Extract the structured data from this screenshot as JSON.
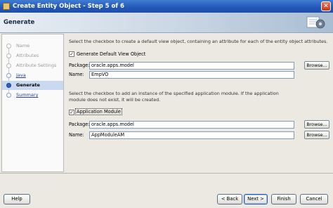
{
  "window": {
    "title": "Create Entity Object - Step 5 of 6"
  },
  "header": {
    "title": "Generate"
  },
  "nav": {
    "items": [
      {
        "label": "Name",
        "state": "done"
      },
      {
        "label": "Attributes",
        "state": "done"
      },
      {
        "label": "Attribute Settings",
        "state": "done"
      },
      {
        "label": "Java",
        "state": "link"
      },
      {
        "label": "Generate",
        "state": "current"
      },
      {
        "label": "Summary",
        "state": "link"
      }
    ]
  },
  "section1": {
    "description": "Select the checkbox to create a default view object, containing an attribute for each of the entity object attributes.",
    "checkbox_label": "Generate Default View Object",
    "checked": true,
    "package_label": "Package:",
    "package_value": "oracle.apps.model",
    "name_label": "Name:",
    "name_value": "EmpVO",
    "browse_label": "Browse..."
  },
  "section2": {
    "description_line1": "Select the checkbox to add an instance of the specified application module.  If the application",
    "description_line2": "module does not exist, it will be created.",
    "checkbox_label": "Application Module",
    "checked": true,
    "package_label": "Package:",
    "package_value": "oracle.apps.model",
    "name_label": "Name:",
    "name_value": "AppModuleAM",
    "browse_label": "Browse...",
    "browse2_label": "Browse..."
  },
  "buttons": {
    "help": "Help",
    "back": "< Back",
    "next": "Next >",
    "finish": "Finish",
    "cancel": "Cancel"
  },
  "icons": {
    "close": "close-icon",
    "gear": "gear-icon",
    "app": "app-icon"
  }
}
